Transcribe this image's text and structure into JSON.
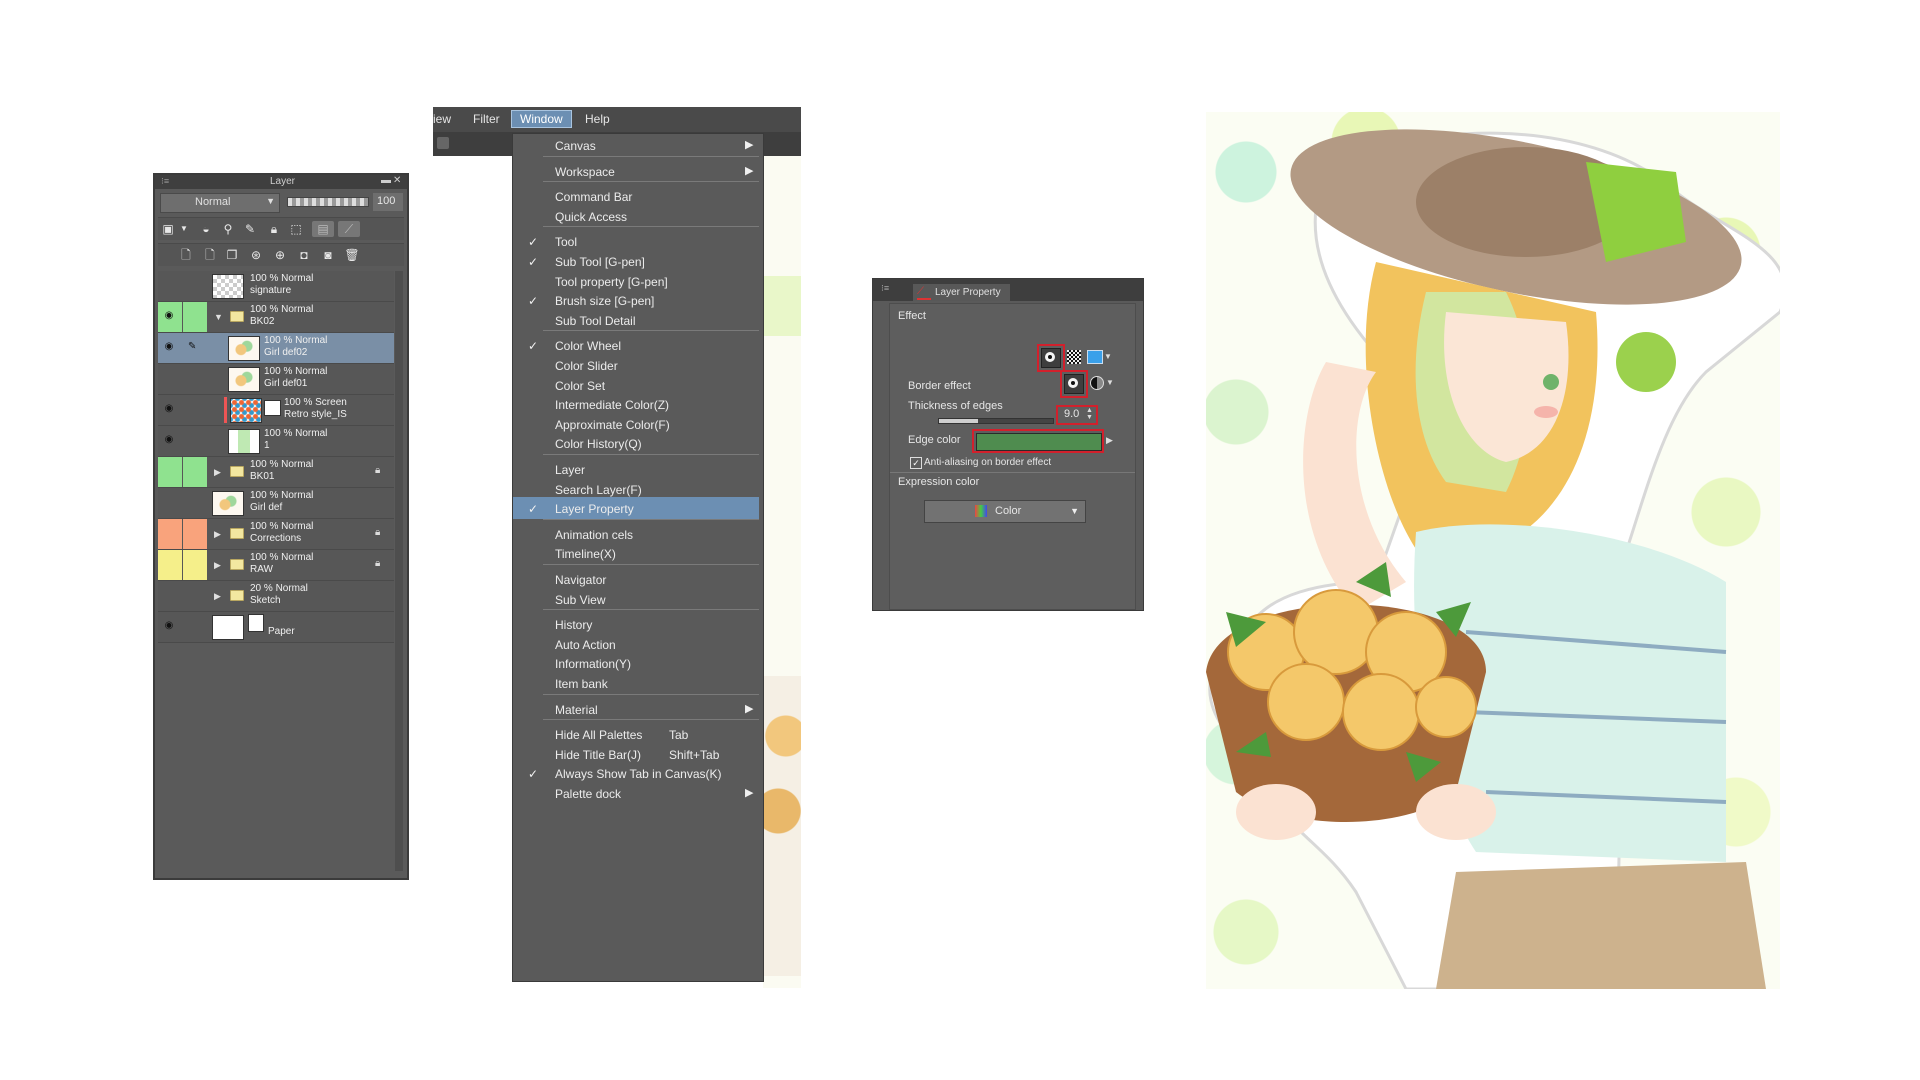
{
  "layer_panel": {
    "title": "Layer",
    "blend_mode": "Normal",
    "opacity": "100",
    "layers": [
      {
        "mode": "100 % Normal",
        "name": "signature",
        "kind": "layer",
        "thumb": "checker"
      },
      {
        "mode": "100 % Normal",
        "name": "BK02",
        "kind": "folder",
        "expanded": true,
        "visible": true,
        "color": "#8fe28f"
      },
      {
        "mode": "100 % Normal",
        "name": "Girl def02",
        "kind": "layer",
        "selected": true,
        "visible": true,
        "thumb": "art"
      },
      {
        "mode": "100 % Normal",
        "name": "Girl def01",
        "kind": "layer",
        "thumb": "art"
      },
      {
        "mode": "100 % Screen",
        "name": "Retro style_IS",
        "kind": "layer",
        "visible": true,
        "thumb": "dots"
      },
      {
        "mode": "100 % Normal",
        "name": "1",
        "kind": "layer",
        "visible": true,
        "thumb": "green"
      },
      {
        "mode": "100 % Normal",
        "name": "BK01",
        "kind": "folder",
        "color": "#8fe28f",
        "locked": true
      },
      {
        "mode": "100 % Normal",
        "name": "Girl def",
        "kind": "layer",
        "thumb": "art"
      },
      {
        "mode": "100 % Normal",
        "name": "Corrections",
        "kind": "folder",
        "color": "#f9a37c",
        "locked": true
      },
      {
        "mode": "100 % Normal",
        "name": "RAW",
        "kind": "folder",
        "color": "#f5ef8a",
        "locked": true
      },
      {
        "mode": "20 % Normal",
        "name": "Sketch",
        "kind": "folder"
      },
      {
        "mode": "",
        "name": "Paper",
        "kind": "paper",
        "visible": true,
        "thumb": "white"
      }
    ]
  },
  "menubar": {
    "items": [
      "iew",
      "Filter",
      "Window",
      "Help"
    ],
    "active": "Window"
  },
  "window_menu": {
    "items": [
      {
        "label": "Canvas",
        "submenu": true
      },
      {
        "sep": true
      },
      {
        "label": "Workspace",
        "submenu": true
      },
      {
        "sep": true
      },
      {
        "label": "Command Bar"
      },
      {
        "label": "Quick Access"
      },
      {
        "sep": true
      },
      {
        "label": "Tool",
        "checked": true
      },
      {
        "label": "Sub Tool [G-pen]",
        "checked": true
      },
      {
        "label": "Tool property [G-pen]"
      },
      {
        "label": "Brush size [G-pen]",
        "checked": true
      },
      {
        "label": "Sub Tool Detail"
      },
      {
        "sep": true
      },
      {
        "label": "Color Wheel",
        "checked": true
      },
      {
        "label": "Color Slider"
      },
      {
        "label": "Color Set"
      },
      {
        "label": "Intermediate Color(Z)"
      },
      {
        "label": "Approximate Color(F)"
      },
      {
        "label": "Color History(Q)"
      },
      {
        "sep": true
      },
      {
        "label": "Layer"
      },
      {
        "label": "Search Layer(F)"
      },
      {
        "label": "Layer Property",
        "checked": true,
        "highlighted": true
      },
      {
        "sep": true
      },
      {
        "label": "Animation cels"
      },
      {
        "label": "Timeline(X)"
      },
      {
        "sep": true
      },
      {
        "label": "Navigator"
      },
      {
        "label": "Sub View"
      },
      {
        "sep": true
      },
      {
        "label": "History"
      },
      {
        "label": "Auto Action"
      },
      {
        "label": "Information(Y)"
      },
      {
        "label": "Item bank"
      },
      {
        "sep": true
      },
      {
        "label": "Material",
        "submenu": true
      },
      {
        "sep": true
      },
      {
        "label": "Hide All Palettes",
        "shortcut": "Tab"
      },
      {
        "label": "Hide Title Bar(J)",
        "shortcut": "Shift+Tab"
      },
      {
        "label": "Always Show Tab in Canvas(K)",
        "checked": true
      },
      {
        "label": "Palette dock",
        "submenu": true
      }
    ]
  },
  "layer_property": {
    "tab_label": "Layer Property",
    "effect_label": "Effect",
    "border_effect_label": "Border effect",
    "thickness_label": "Thickness of edges",
    "thickness_value": "9.0",
    "thickness_fraction": 0.35,
    "edge_color_label": "Edge color",
    "edge_color": "#4f8c4f",
    "antialias_label": "Anti-aliasing on border effect",
    "antialias_checked": true,
    "expression_color_label": "Expression color",
    "expression_color_value": "Color"
  },
  "colors": {
    "highlight": "#6c8fb3",
    "annotation_red": "#d2202c"
  }
}
